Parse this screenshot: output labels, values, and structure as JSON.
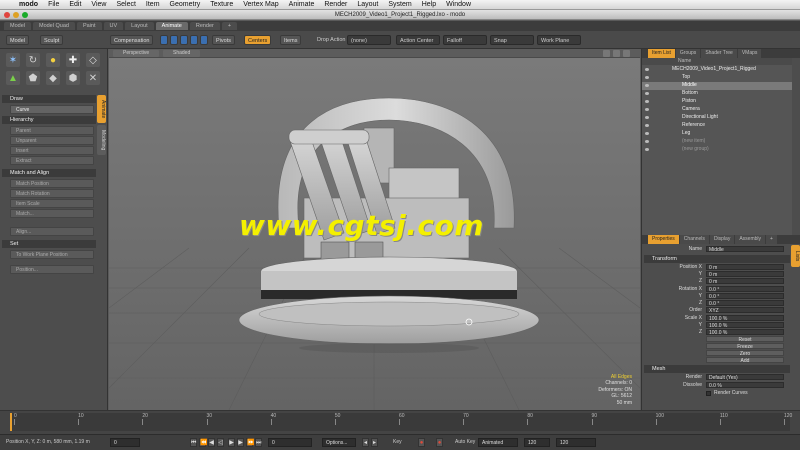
{
  "menubar": {
    "app_name": "modo",
    "items": [
      "File",
      "Edit",
      "View",
      "Select",
      "Item",
      "Geometry",
      "Texture",
      "Vertex Map",
      "Animate",
      "Render",
      "Layout",
      "System",
      "Help",
      "Window"
    ]
  },
  "window": {
    "title": "MECH2009_Video1_Project1_Rigged.lxo - modo"
  },
  "layout_tabs": [
    "Model",
    "Model Quad",
    "Paint",
    "UV",
    "Layout",
    "Animate",
    "Render",
    "+"
  ],
  "active_layout_tab": "Animate",
  "toolbar": {
    "mode_left": [
      "Model",
      "Sculpt"
    ],
    "compensation": "Compensation",
    "pivots": "Pivots",
    "centers": "Centers",
    "items": "Items",
    "drop_action_label": "Drop Action",
    "drop_action_value": "(none)",
    "action_center": "Action Center",
    "falloff": "Falloff",
    "snap": "Snap",
    "work_plane": "Work Plane"
  },
  "left_panel": {
    "draw": {
      "header": "Draw",
      "buttons": [
        "Curve"
      ]
    },
    "hierarchy": {
      "header": "Hierarchy",
      "buttons": [
        "Parent",
        "Unparent",
        "Insert",
        "Extract"
      ]
    },
    "match": {
      "header": "Match and Align",
      "buttons": [
        "Match Position",
        "Match Rotation",
        "Item Scale",
        "Match...",
        "Align..."
      ]
    },
    "set": {
      "header": "Set",
      "buttons": [
        "To Work Plane Position",
        "Position..."
      ]
    },
    "side_tabs": [
      "Animate",
      "Modeling"
    ]
  },
  "viewport": {
    "tabs": [
      "Perspective",
      "Shaded"
    ],
    "stats": [
      "All Edges",
      "Channels: 0",
      "Deformers: ON",
      "GL: 5612",
      "50 mm"
    ],
    "watermark": "www.cgtsj.com"
  },
  "item_list": {
    "tabs": [
      "Item List",
      "Groups",
      "Shader Tree",
      "VMaps"
    ],
    "column_header": "Name",
    "rows": [
      {
        "label": "MECH2009_Video1_Project1_Rigged",
        "indent": 0,
        "selected": false
      },
      {
        "label": "Top",
        "indent": 1,
        "selected": false
      },
      {
        "label": "Middle",
        "indent": 1,
        "selected": true
      },
      {
        "label": "Bottom",
        "indent": 1,
        "selected": false
      },
      {
        "label": "Piston",
        "indent": 1,
        "selected": false
      },
      {
        "label": "Camera",
        "indent": 1,
        "selected": false
      },
      {
        "label": "Directional Light",
        "indent": 1,
        "selected": false
      },
      {
        "label": "Reference",
        "indent": 1,
        "selected": false
      },
      {
        "label": "Leg",
        "indent": 1,
        "selected": false
      },
      {
        "label": "(new item)",
        "indent": 1,
        "selected": false
      },
      {
        "label": "(new group)",
        "indent": 1,
        "selected": false
      }
    ]
  },
  "properties": {
    "tabs": [
      "Properties",
      "Channels",
      "Display",
      "Assembly",
      "+"
    ],
    "name_label": "Name",
    "name_value": "Middle",
    "transform_header": "Transform",
    "position": [
      {
        "label": "Position X",
        "value": "0 m"
      },
      {
        "label": "Y",
        "value": "0 m"
      },
      {
        "label": "Z",
        "value": "0 m"
      }
    ],
    "rotation": [
      {
        "label": "Rotation X",
        "value": "0.0 °"
      },
      {
        "label": "Y",
        "value": "0.0 °"
      },
      {
        "label": "Z",
        "value": "0.0 °"
      }
    ],
    "order_label": "Order",
    "order_value": "XYZ",
    "scale": [
      {
        "label": "Scale X",
        "value": "100.0 %"
      },
      {
        "label": "Y",
        "value": "100.0 %"
      },
      {
        "label": "Z",
        "value": "100.0 %"
      }
    ],
    "actions": [
      "Reset",
      "Freeze",
      "Zero",
      "Add"
    ],
    "mesh_header": "Mesh",
    "render_label": "Render",
    "render_value": "Default (Yes)",
    "dissolve_label": "Dissolve",
    "dissolve_value": "0.0 %",
    "render_curves": "Render Curves",
    "side_tab": "Lists"
  },
  "timeline": {
    "ticks": [
      "0",
      "10",
      "20",
      "30",
      "40",
      "50",
      "60",
      "70",
      "80",
      "90",
      "100",
      "110",
      "120"
    ]
  },
  "statusbar": {
    "position": "Position X, Y, Z:  0 m, 580 mm, 1.19 m",
    "start": "0",
    "current": "0",
    "options": "Options...",
    "key": "Key",
    "auto_key": "Auto Key",
    "animated": "Animated",
    "end_a": "120",
    "end_b": "120"
  }
}
